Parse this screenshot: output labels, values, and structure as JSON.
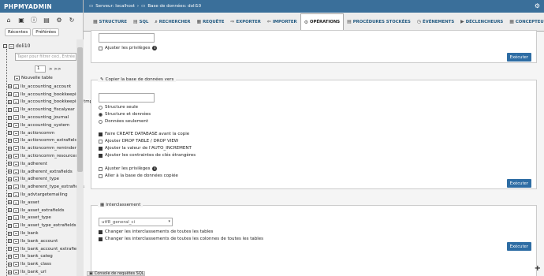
{
  "sidebar": {
    "logo": "PHPMYADMIN",
    "tabs": [
      "Récentes",
      "Préférées"
    ],
    "database": "doli10",
    "filter_placeholder": "Taper pour filtrer ceci, Entrée pour",
    "page_value": "1",
    "page_next": "> >>",
    "new_table": "Nouvelle table",
    "tables": [
      "llx_accounting_account",
      "llx_accounting_bookkeeping",
      "llx_accounting_bookkeeping_tmp",
      "llx_accounting_fiscalyear",
      "llx_accounting_journal",
      "llx_accounting_system",
      "llx_actioncomm",
      "llx_actioncomm_extrafields",
      "llx_actioncomm_reminder",
      "llx_actioncomm_resources",
      "llx_adherent",
      "llx_adherent_extrafields",
      "llx_adherent_type",
      "llx_adherent_type_extrafields",
      "llx_advtargetemailing",
      "llx_asset",
      "llx_asset_extrafields",
      "llx_asset_type",
      "llx_asset_type_extrafields",
      "llx_bank",
      "llx_bank_account",
      "llx_bank_account_extrafields",
      "llx_bank_categ",
      "llx_bank_class",
      "llx_bank_url"
    ]
  },
  "topbar": {
    "server": "Serveur: localhost",
    "database": "Base de données: doli10"
  },
  "nav": {
    "tabs": [
      {
        "label": "STRUCTURE",
        "icon": "▦"
      },
      {
        "label": "SQL",
        "icon": "▤"
      },
      {
        "label": "RECHERCHER",
        "icon": "⌕"
      },
      {
        "label": "REQUÊTE",
        "icon": "▦"
      },
      {
        "label": "EXPORTER",
        "icon": "⇨"
      },
      {
        "label": "IMPORTER",
        "icon": "⇦"
      },
      {
        "label": "OPÉRATIONS",
        "icon": "⚙"
      },
      {
        "label": "PROCÉDURES STOCKÉES",
        "icon": "▤"
      },
      {
        "label": "ÉVÉNEMENTS",
        "icon": "◷"
      },
      {
        "label": "DÉCLENCHEURS",
        "icon": "▶"
      },
      {
        "label": "CONCEPTEUR",
        "icon": "▦"
      }
    ]
  },
  "rename": {
    "privileges_label": "Ajuster les privilèges",
    "execute": "Exécuter"
  },
  "copy": {
    "legend": "Copier la base de données vers",
    "radios": [
      "Structure seule",
      "Structure et données",
      "Données seulement"
    ],
    "checks": [
      "Faire CREATE DATABASE avant la copie",
      "Ajouter DROP TABLE / DROP VIEW",
      "Ajouter la valeur de l'AUTO_INCREMENT",
      "Ajouter les contraintes de clés étrangères"
    ],
    "privileges_label": "Ajuster les privilèges",
    "switch_label": "Aller à la base de données copiée",
    "execute": "Exécuter"
  },
  "collation": {
    "legend": "Interclassement",
    "value": "utf8_general_ci",
    "checks": [
      "Changer les interclassements de toutes les tables",
      "Changer les interclassements de toutes les colonnes de toutes les tables"
    ],
    "execute": "Exécuter"
  },
  "console": {
    "label": "Console de requêtes SQL"
  }
}
